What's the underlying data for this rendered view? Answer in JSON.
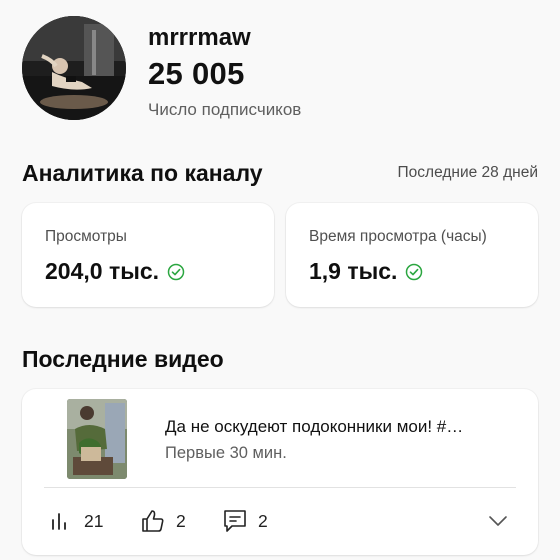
{
  "channel": {
    "name": "mrrrmaw",
    "subscriber_count": "25 005",
    "subscriber_label": "Число подписчиков"
  },
  "analytics": {
    "title": "Аналитика по каналу",
    "period": "Последние 28 дней",
    "stats": [
      {
        "label": "Просмотры",
        "value": "204,0 тыс.",
        "status_icon": "check-circle-icon"
      },
      {
        "label": "Время просмотра (часы)",
        "value": "1,9 тыс.",
        "status_icon": "check-circle-icon"
      }
    ]
  },
  "recent_videos": {
    "title": "Последние видео",
    "items": [
      {
        "title": "Да не оскудеют подоконники мои!  #…",
        "subtitle": "Первые 30 мин.",
        "views": "21",
        "likes": "2",
        "comments": "2"
      }
    ]
  },
  "colors": {
    "background": "#f9f9f9",
    "card": "#ffffff",
    "check_green": "#2ba640",
    "text_primary": "#0f0f0f",
    "text_secondary": "#5f5f5f"
  },
  "icons": {
    "views": "bar-chart-icon",
    "likes": "thumbs-up-icon",
    "comments": "comment-icon",
    "expand": "chevron-down-icon"
  }
}
